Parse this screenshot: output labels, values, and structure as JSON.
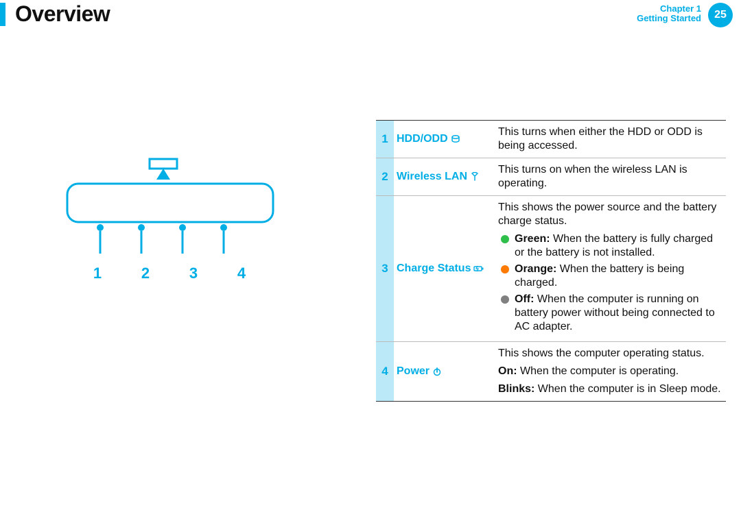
{
  "header": {
    "title": "Overview",
    "chapter_line1": "Chapter 1",
    "chapter_line2": "Getting Started",
    "page_number": "25"
  },
  "diagram": {
    "callouts": [
      "1",
      "2",
      "3",
      "4"
    ]
  },
  "indicators": [
    {
      "num": "1",
      "name": "HDD/ODD",
      "icon": "cylinder-icon",
      "desc_plain": "This turns when either the HDD or ODD is being accessed."
    },
    {
      "num": "2",
      "name": "Wireless LAN",
      "icon": "antenna-icon",
      "desc_plain": "This turns on when the wireless LAN is operating."
    },
    {
      "num": "3",
      "name": "Charge Status",
      "icon": "battery-charge-icon",
      "intro": "This shows the power source and the battery charge status.",
      "bullets": [
        {
          "color": "green",
          "label": "Green:",
          "text": "When the battery is fully charged or the battery is not installed."
        },
        {
          "color": "orange",
          "label": "Orange:",
          "text": "When the battery is being charged."
        },
        {
          "color": "grey",
          "label": "Off:",
          "text": "When the computer is running on battery power without being connected to AC adapter."
        }
      ]
    },
    {
      "num": "4",
      "name": "Power",
      "icon": "power-icon",
      "intro": "This shows the computer operating status.",
      "states": [
        {
          "label": "On:",
          "text": "When the computer is operating."
        },
        {
          "label": "Blinks:",
          "text": "When the computer is in Sleep mode."
        }
      ]
    }
  ]
}
